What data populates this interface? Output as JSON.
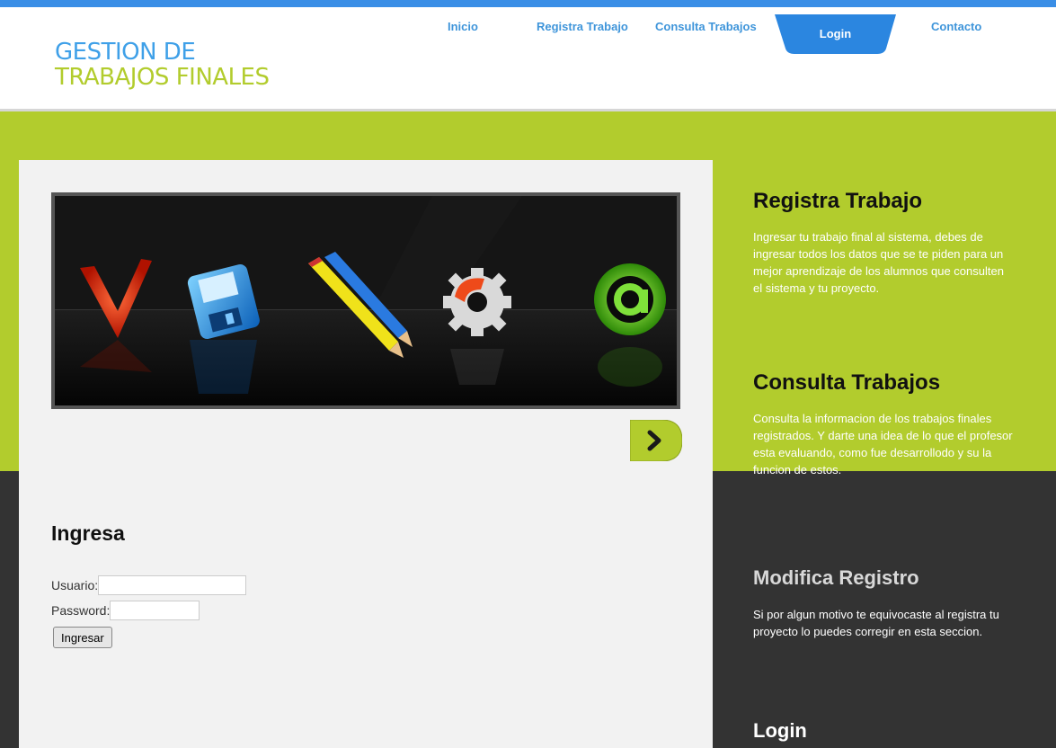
{
  "colors": {
    "top_bar": "#3a8ee6",
    "logo_blue": "#3fa0e8",
    "logo_green": "#b2cc2d",
    "nav_link": "#3f95da",
    "nav_active_tab": "#2b86e0",
    "green_band": "#b2cc2d",
    "dark_band": "#333333",
    "panel": "#f2f2f2"
  },
  "logo": {
    "line1": "GESTION DE",
    "line2": "TRABAJOS FINALES"
  },
  "nav": {
    "items": [
      {
        "label": "Inicio"
      },
      {
        "label": "Registra Trabajo"
      },
      {
        "label": "Consulta Trabajos"
      },
      {
        "label": "Login",
        "active": true
      },
      {
        "label": "Contacto"
      }
    ]
  },
  "slider": {
    "icons": [
      "checkmark-icon",
      "floppy-disk-icon",
      "pencils-icon",
      "gear-icon",
      "at-sign-icon"
    ],
    "next_icon": "chevron-right-icon"
  },
  "login_form": {
    "title": "Ingresa",
    "user_label": "Usuario:",
    "user_value": "",
    "password_label": "Password:",
    "password_value": "",
    "submit_label": "Ingresar"
  },
  "sidebar": {
    "sections": [
      {
        "title": "Registra Trabajo",
        "text": "Ingresar tu trabajo final al sistema, debes de ingresar todos los datos que se te piden para un mejor aprendizaje de los alumnos que consulten el sistema y tu proyecto."
      },
      {
        "title": "Consulta Trabajos",
        "text": "Consulta la informacion de los trabajos finales registrados. Y darte una idea de lo que el profesor esta evaluando, como fue desarrollodo y su la funcion de estos."
      },
      {
        "title": "Modifica Registro",
        "text": "Si por algun motivo te equivocaste al registra tu proyecto lo puedes corregir en esta seccion."
      },
      {
        "title": "Login",
        "text": ""
      }
    ]
  }
}
